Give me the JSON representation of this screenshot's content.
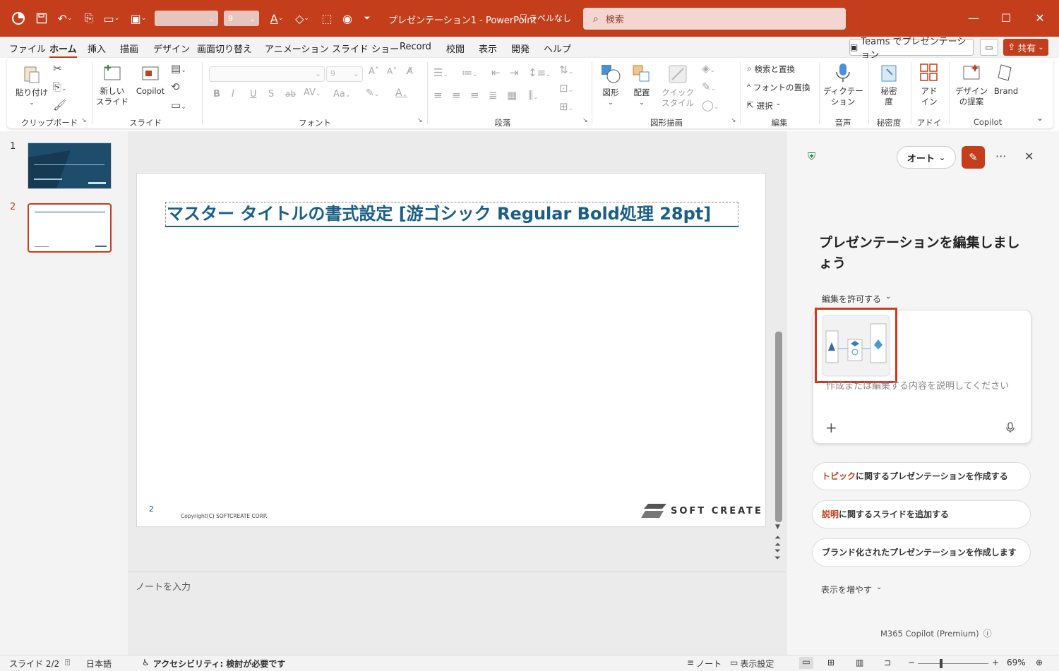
{
  "window": {
    "title": "プレゼンテーション1 - PowerPoint",
    "label": "ラベルなし",
    "search_placeholder": "検索",
    "font_size_qa": "9"
  },
  "menu": {
    "tabs": [
      "ファイル",
      "ホーム",
      "挿入",
      "描画",
      "デザイン",
      "画面切り替え",
      "アニメーション",
      "スライド ショー",
      "Record",
      "校閲",
      "表示",
      "開発",
      "ヘルプ"
    ],
    "active": "ホーム",
    "teams": "Teams でプレゼンテーション",
    "share": "共有"
  },
  "ribbon": {
    "paste": "貼り付け",
    "new_slide": "新しい\nスライド",
    "copilot_btn": "Copilot",
    "font_size": "9",
    "find_replace": "検索と置換",
    "font_replace": "フォントの置換",
    "select": "選択",
    "shapes": "図形",
    "arrange": "配置",
    "quick_styles": "クイック\nスタイル",
    "dictate": "ディクテー\nション",
    "sensitivity": "秘密\n度",
    "addins": "アド\nイン",
    "design_ideas": "デザイン\nの提案",
    "brand": "Brand",
    "groups": {
      "clipboard": "クリップボード",
      "slides": "スライド",
      "font": "フォント",
      "paragraph": "段落",
      "drawing": "図形描画",
      "editing": "編集",
      "voice": "音声",
      "sensitivity": "秘密度",
      "addins": "アドイン",
      "copilot": "Copilot"
    }
  },
  "slides": {
    "numbers": [
      "1",
      "2"
    ]
  },
  "slide": {
    "title": "マスター タイトルの書式設定 [游ゴシック Regular Bold処理 28pt]",
    "page": "2",
    "copyright": "Copyright(C) SOFTCREATE CORP.",
    "logo": "SOFT CREATE"
  },
  "notes": {
    "placeholder": "ノートを入力"
  },
  "copilot": {
    "mode": "オート",
    "heading": "プレゼンテーションを編集しましょう",
    "permission": "編集を許可する",
    "prompt_placeholder": "作成または編集する内容を説明してください",
    "suggestions": [
      {
        "hl": "トピック",
        "rest": "に関するプレゼンテーションを作成する"
      },
      {
        "hl": "説明",
        "rest": "に関するスライドを追加する"
      },
      {
        "hl": "",
        "rest": "ブランド化されたプレゼンテーションを作成します"
      }
    ],
    "more": "表示を増やす",
    "footer": "M365 Copilot (Premium)"
  },
  "status": {
    "slide": "スライド 2/2",
    "lang": "日本語",
    "a11y": "アクセシビリティ: 検討が必要です",
    "notes": "ノート",
    "display": "表示設定",
    "zoom": "69%"
  },
  "colors": {
    "accent": "#c43e1c",
    "title_blue": "#1a5e86"
  }
}
